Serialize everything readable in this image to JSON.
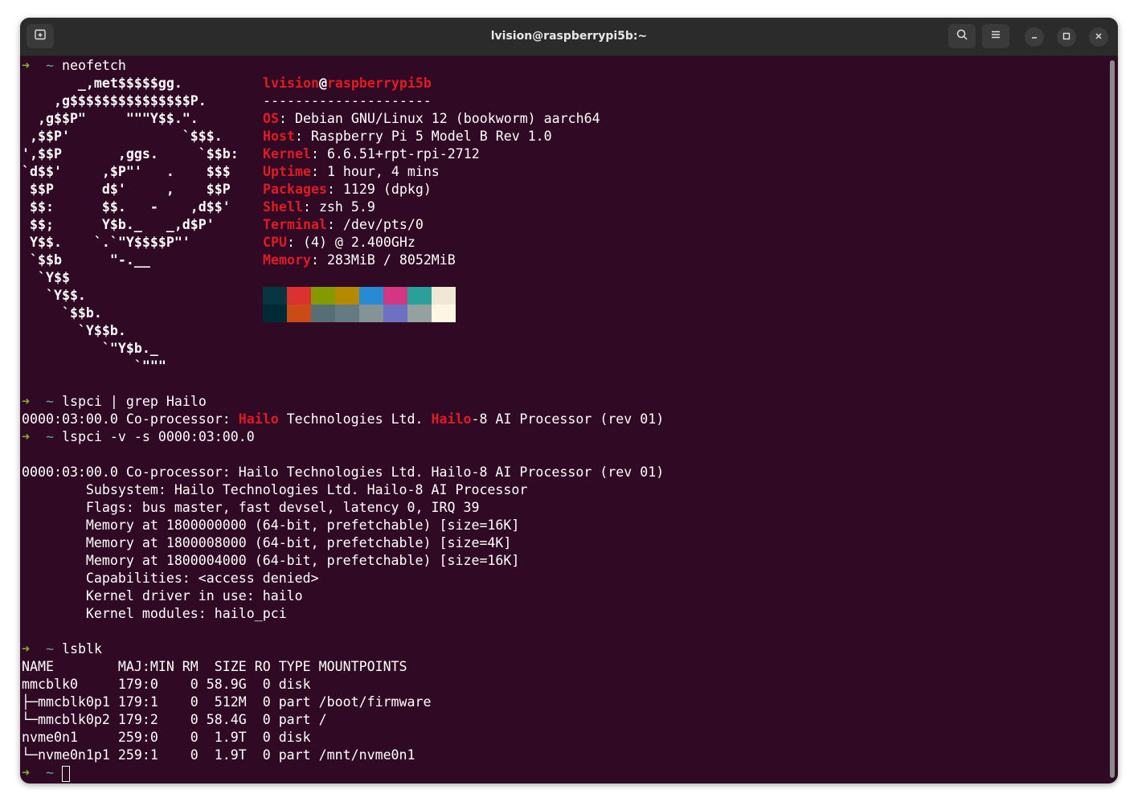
{
  "window": {
    "title": "lvision@raspberrypi5b:~"
  },
  "icons": {
    "new_tab": "new-tab-icon",
    "search": "search-icon",
    "menu": "hamburger-menu-icon",
    "minimize": "minimize-icon",
    "maximize": "maximize-icon",
    "close": "close-icon"
  },
  "prompt": {
    "arrow": "➜",
    "dir": "~"
  },
  "commands": {
    "c1": "neofetch",
    "c2": "lspci | grep Hailo",
    "c3": "lspci -v -s 0000:03:00.0",
    "c4": "lsblk"
  },
  "ascii_art": [
    "       _,met$$$$$gg.",
    "    ,g$$$$$$$$$$$$$$$P.",
    "  ,g$$P\"     \"\"\"Y$$.\".",
    " ,$$P'              `$$$.",
    "',$$P       ,ggs.     `$$b:",
    "`d$$'     ,$P\"'   .    $$$",
    " $$P      d$'     ,    $$P",
    " $$:      $$.   -    ,d$$'",
    " $$;      Y$b._   _,d$P'",
    " Y$$.    `.`\"Y$$$$P\"'",
    " `$$b      \"-.__",
    "  `Y$$",
    "   `Y$$.",
    "     `$$b.",
    "       `Y$$b.",
    "          `\"Y$b._",
    "              `\"\"\""
  ],
  "neofetch": {
    "user": "lvision",
    "at": "@",
    "host": "raspberrypi5b",
    "separator": "---------------------",
    "fields": [
      {
        "label": "OS",
        "value": "Debian GNU/Linux 12 (bookworm) aarch64"
      },
      {
        "label": "Host",
        "value": "Raspberry Pi 5 Model B Rev 1.0"
      },
      {
        "label": "Kernel",
        "value": "6.6.51+rpt-rpi-2712"
      },
      {
        "label": "Uptime",
        "value": "1 hour, 4 mins"
      },
      {
        "label": "Packages",
        "value": "1129 (dpkg)"
      },
      {
        "label": "Shell",
        "value": "zsh 5.9"
      },
      {
        "label": "Terminal",
        "value": "/dev/pts/0"
      },
      {
        "label": "CPU",
        "value": "(4) @ 2.400GHz"
      },
      {
        "label": "Memory",
        "value": "283MiB / 8052MiB"
      }
    ],
    "palette": [
      "#073642",
      "#dc322f",
      "#859900",
      "#b58900",
      "#268bd2",
      "#d33682",
      "#2aa198",
      "#eee8d5",
      "#002b36",
      "#cb4b16",
      "#586e75",
      "#657b83",
      "#839496",
      "#6c71c4",
      "#93a1a1",
      "#fdf6e3"
    ]
  },
  "grep_result": {
    "prefix": "0000:03:00.0 Co-processor: ",
    "match1": "Hailo",
    "middle": " Technologies Ltd. ",
    "match2": "Hailo",
    "suffix": "-8 AI Processor (rev 01)"
  },
  "lspci_verbose": [
    "0000:03:00.0 Co-processor: Hailo Technologies Ltd. Hailo-8 AI Processor (rev 01)",
    "        Subsystem: Hailo Technologies Ltd. Hailo-8 AI Processor",
    "        Flags: bus master, fast devsel, latency 0, IRQ 39",
    "        Memory at 1800000000 (64-bit, prefetchable) [size=16K]",
    "        Memory at 1800008000 (64-bit, prefetchable) [size=4K]",
    "        Memory at 1800004000 (64-bit, prefetchable) [size=16K]",
    "        Capabilities: <access denied>",
    "        Kernel driver in use: hailo",
    "        Kernel modules: hailo_pci"
  ],
  "lsblk": [
    "NAME        MAJ:MIN RM  SIZE RO TYPE MOUNTPOINTS",
    "mmcblk0     179:0    0 58.9G  0 disk",
    "├─mmcblk0p1 179:1    0  512M  0 part /boot/firmware",
    "└─mmcblk0p2 179:2    0 58.4G  0 part /",
    "nvme0n1     259:0    0  1.9T  0 disk",
    "└─nvme0n1p1 259:1    0  1.9T  0 part /mnt/nvme0n1"
  ]
}
